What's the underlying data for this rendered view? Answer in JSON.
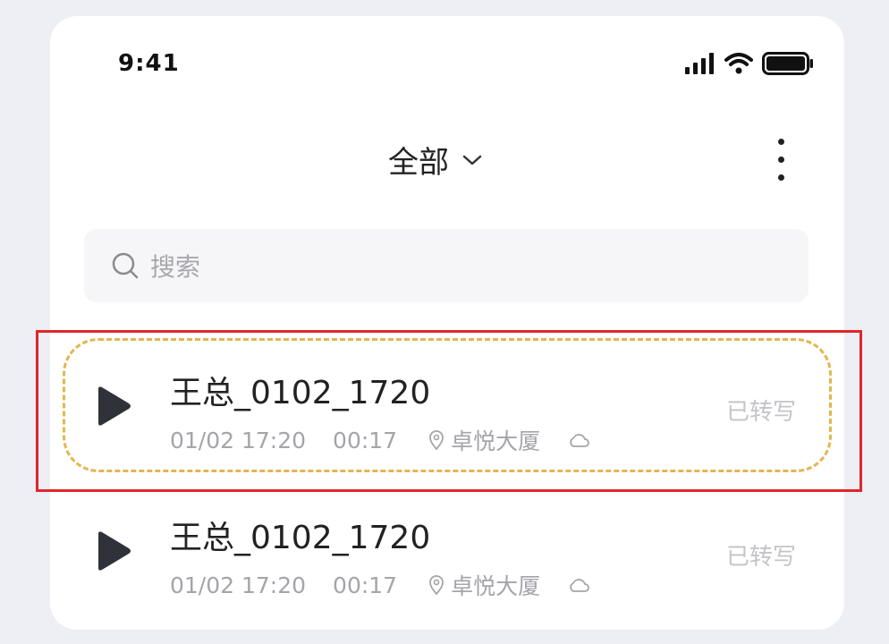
{
  "status_bar": {
    "time": "9:41",
    "icons": [
      "signal-icon",
      "wifi-icon",
      "battery-icon"
    ]
  },
  "header": {
    "filter_label": "全部",
    "filter_icon": "chevron-down-icon",
    "more_icon": "more-vertical-icon"
  },
  "search": {
    "placeholder": "搜索",
    "icon": "search-icon"
  },
  "recordings": [
    {
      "title": "王总_0102_1720",
      "date": "01/02 17:20",
      "duration": "00:17",
      "location": "卓悦大厦",
      "status": "已转写",
      "highlighted": true
    },
    {
      "title": "王总_0102_1720",
      "date": "01/02 17:20",
      "duration": "00:17",
      "location": "卓悦大厦",
      "status": "已转写",
      "highlighted": false
    }
  ],
  "colors": {
    "background": "#eeeef5",
    "card": "#ffffff",
    "dashed_border": "#e2b650",
    "highlight_border": "#e0262a",
    "play_icon": "#2f3238",
    "meta_text": "#a4a4aa"
  }
}
